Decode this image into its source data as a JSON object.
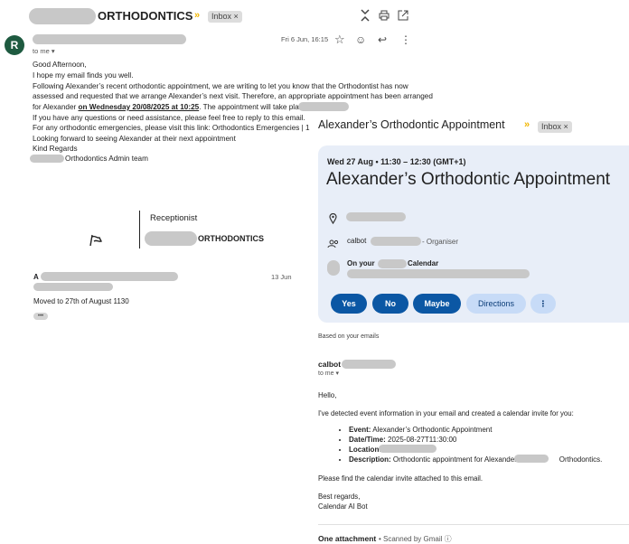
{
  "header": {
    "subject_suffix": "ORTHODONTICS",
    "inbox_label": "Inbox ×"
  },
  "email1": {
    "avatar_letter": "R",
    "date": "Fri 6 Jun, 16:15",
    "to": "to me ▾",
    "lines": {
      "l1": "Good Afternoon,",
      "l2": "I hope my email finds you well.",
      "l3": "Following Alexander’s recent orthodontic appointment, we are writing to let you know that the Orthodontist has now",
      "l4": "assessed and requested that we arrange Alexander’s next visit. Therefore, an appropriate appointment has been arranged",
      "l5a": "for Alexander ",
      "l5b": "on Wednesday 20/08/2025 at 10:25",
      "l5c": ". The appointment will take place at",
      "l6": "If you have any questions or need assistance, please feel free to reply to this email.",
      "l7": "For any orthodontic emergencies, please visit this link: Orthodontics Emergencies | 1",
      "l8": "Looking forward to seeing Alexander at their next appointment",
      "l9": "Kind Regards",
      "l10": "Orthodontics Admin team"
    },
    "signature": {
      "role": "Receptionist",
      "org": "ORTHODONTICS"
    }
  },
  "email2": {
    "sender_initial": "A",
    "date": "13 Jun",
    "snippet": "Moved to 27th of August 1130",
    "more": "•••"
  },
  "calendar_email": {
    "title": "Alexander’s Orthodontic Appointment",
    "inbox_label": "Inbox ×",
    "card": {
      "datetime": "Wed 27 Aug • 11:30 – 12:30 (GMT+1)",
      "title": "Alexander’s Orthodontic Appointment",
      "organiser_prefix": "calbot",
      "organiser_suffix": "- Organiser",
      "calendar_prefix": "On your",
      "calendar_suffix": "Calendar",
      "buttons": {
        "yes": "Yes",
        "no": "No",
        "maybe": "Maybe",
        "directions": "Directions",
        "more": "⋮"
      }
    },
    "based_on": "Based on your emails",
    "sender_prefix": "calbot",
    "to": "to me ▾",
    "hello": "Hello,",
    "intro": "I've detected event information in your email and created a calendar invite for you:",
    "details": {
      "event_label": "Event:",
      "event_value": " Alexander’s Orthodontic Appointment",
      "datetime_label": "Date/Time:",
      "datetime_value": " 2025-08-27T11:30:00",
      "location_label": "Location:",
      "description_label": "Description:",
      "description_value_a": " Orthodontic appointment for Alexander at",
      "description_value_b": "Orthodontics."
    },
    "attached": "Please find the calendar invite attached to this email.",
    "regards": "Best regards,",
    "bot_name": "Calendar AI Bot",
    "attachment_title": "One attachment",
    "scanned": "• Scanned by Gmail ⓘ"
  },
  "colors": {
    "accent_blue": "#0b57a4",
    "light_blue": "#c7dbf7",
    "card_bg": "#e8eef8",
    "avatar_green": "#1e5a40",
    "chevron_yellow": "#f2b600"
  }
}
